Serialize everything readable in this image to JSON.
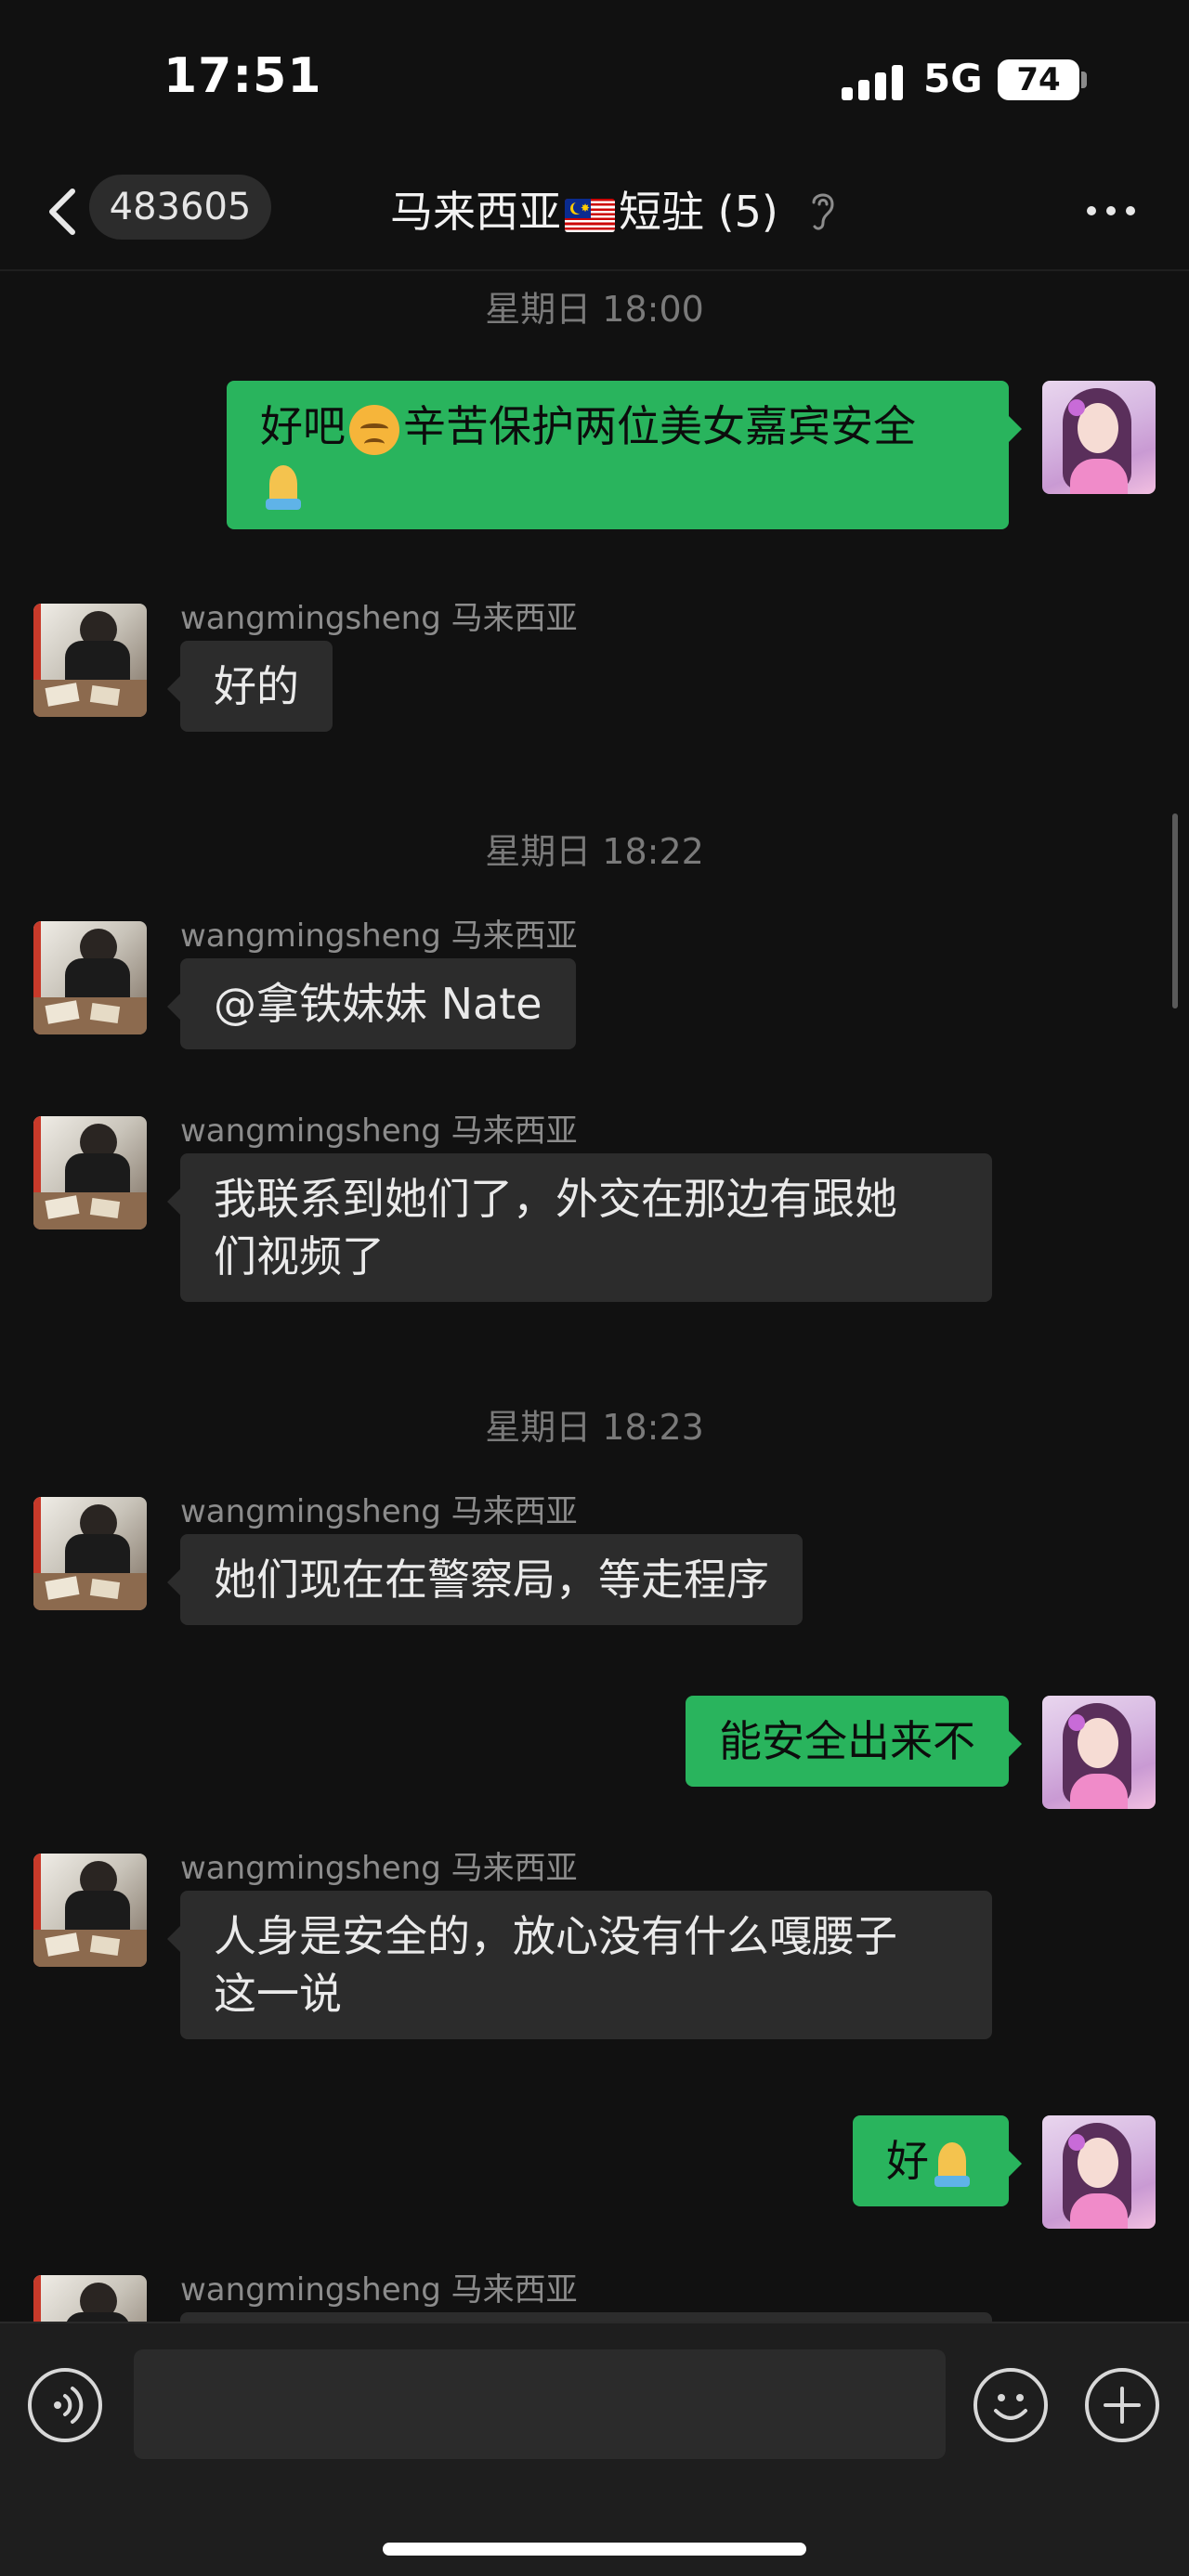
{
  "status_bar": {
    "time": "17:51",
    "network": "5G",
    "battery": "74"
  },
  "header": {
    "unread_count": "483605",
    "title_part1": "马来西亚",
    "title_flag": "malaysia-flag",
    "title_part2": "短驻",
    "member_count": "(5)",
    "icons": [
      "back-chevron-icon",
      "ear-icon",
      "more-icon"
    ]
  },
  "messages": [
    {
      "type": "timestamp",
      "text": "星期日 18:00"
    },
    {
      "type": "outgoing",
      "text_a": "好吧",
      "emoji_a": "disappointed-face",
      "text_b": "辛苦保护两位美女嘉宾安全",
      "emoji_b": "folded-hands"
    },
    {
      "type": "incoming",
      "sender": "wangmingsheng 马来西亚",
      "text": "好的"
    },
    {
      "type": "timestamp",
      "text": "星期日 18:22"
    },
    {
      "type": "incoming",
      "sender": "wangmingsheng 马来西亚",
      "text": "@拿铁妹妹 Nate"
    },
    {
      "type": "incoming",
      "sender": "wangmingsheng 马来西亚",
      "line1": "我联系到她们了，外交在那边有跟她",
      "line2": "们视频了"
    },
    {
      "type": "timestamp",
      "text": "星期日 18:23"
    },
    {
      "type": "incoming",
      "sender": "wangmingsheng 马来西亚",
      "text": "她们现在在警察局，等走程序"
    },
    {
      "type": "outgoing",
      "text": "能安全出来不"
    },
    {
      "type": "incoming",
      "sender": "wangmingsheng 马来西亚",
      "line1": "人身是安全的，放心没有什么嘎腰子",
      "line2": "这一说"
    },
    {
      "type": "outgoing",
      "text": "好",
      "emoji": "folded-hands"
    },
    {
      "type": "incoming",
      "sender": "wangmingsheng 马来西亚",
      "text": ""
    }
  ],
  "input_bar": {
    "placeholder": "",
    "icons": [
      "voice-icon",
      "emoji-icon",
      "plus-icon"
    ]
  },
  "colors": {
    "background": "#111111",
    "bubble_in": "#2c2c2c",
    "bubble_out": "#29b45d",
    "timestamp": "#7a7a7a",
    "sender": "#8c8c8c"
  }
}
